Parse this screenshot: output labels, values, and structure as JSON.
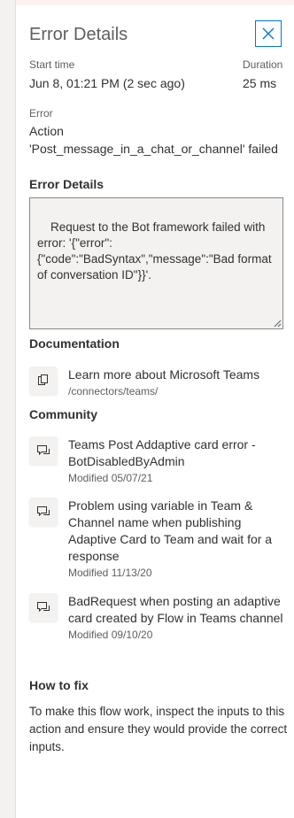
{
  "panel": {
    "title": "Error Details",
    "close_label": "Close"
  },
  "summary": {
    "start_time_label": "Start time",
    "start_time_value": "Jun 8, 01:21 PM (2 sec ago)",
    "duration_label": "Duration",
    "duration_value": "25 ms",
    "error_label": "Error",
    "error_value": "Action 'Post_message_in_a_chat_or_channel' failed"
  },
  "error_details": {
    "heading": "Error Details",
    "text": "Request to the Bot framework failed with error: '{\"error\":\n{\"code\":\"BadSyntax\",\"message\":\"Bad format of conversation ID\"}}'."
  },
  "documentation": {
    "heading": "Documentation",
    "items": [
      {
        "title": "Learn more about Microsoft Teams",
        "sub": "/connectors/teams/",
        "icon": "document-icon"
      }
    ]
  },
  "community": {
    "heading": "Community",
    "items": [
      {
        "title": "Teams Post Addaptive card error - BotDisabledByAdmin",
        "sub": "Modified 05/07/21",
        "icon": "chat-icon"
      },
      {
        "title": "Problem using variable in Team & Channel name when publishing Adaptive Card to Team and wait for a response",
        "sub": "Modified 11/13/20",
        "icon": "chat-icon"
      },
      {
        "title": "BadRequest when posting an adaptive card created by Flow in Teams channel",
        "sub": "Modified 09/10/20",
        "icon": "chat-icon"
      }
    ]
  },
  "how_to_fix": {
    "heading": "How to fix",
    "text": "To make this flow work, inspect the inputs to this action and ensure they would provide the correct inputs."
  },
  "colors": {
    "accent": "#0078d4",
    "text": "#323130",
    "secondary_text": "#605e5c",
    "box_bg": "#f3f2f1"
  }
}
